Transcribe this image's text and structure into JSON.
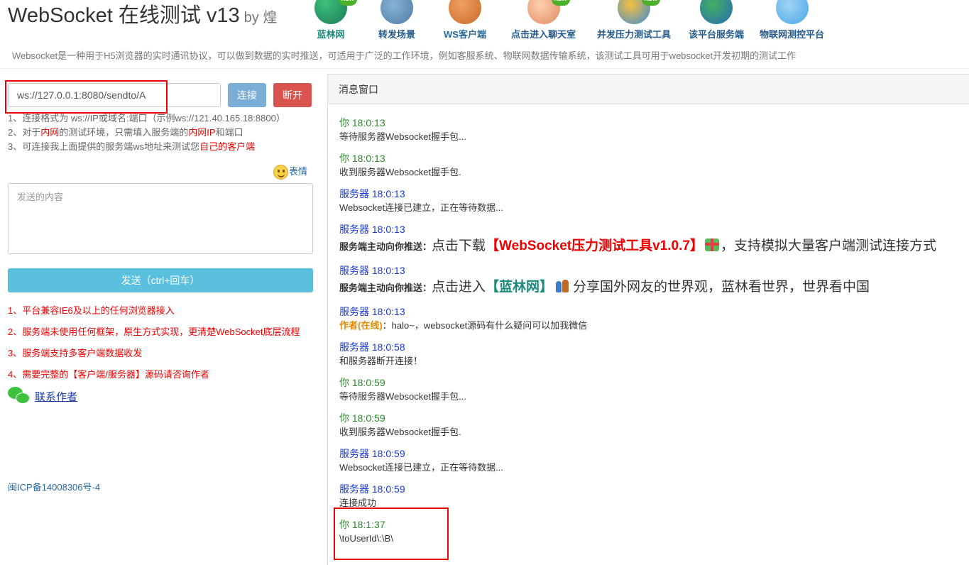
{
  "header": {
    "title": "WebSocket 在线测试 v13",
    "by": "by 煌",
    "description": "Websocket是一种用于H5浏览器的实时通讯协议，可以做到数据的实时推送，可适用于广泛的工作环境，例如客服系统、物联网数据传输系统，该测试工具可用于websocket开发初期的测试工作"
  },
  "nav": {
    "items": [
      {
        "label": "蓝林网",
        "icon": "globe-icon",
        "new": "NEW"
      },
      {
        "label": "转发场景",
        "icon": "antenna-icon"
      },
      {
        "label": "WS客户端",
        "icon": "phone-icon"
      },
      {
        "label": "点击进入聊天室",
        "icon": "chat-people-icon",
        "new": "NEW"
      },
      {
        "label": "并发压力测试工具",
        "icon": "rocket-tool-icon",
        "new": "NEW"
      },
      {
        "label": "该平台服务端",
        "icon": "server-globe-icon"
      },
      {
        "label": "物联网测控平台",
        "icon": "cloud-icon"
      }
    ]
  },
  "connect": {
    "url": "ws://127.0.0.1:8080/sendto/A",
    "connect_label": "连接",
    "disconnect_label": "断开",
    "tip1": "1、连接格式为 ws://IP或域名:端口（示例ws://121.40.165.18:8800）",
    "tip2_a": "2、对于",
    "tip2_b": "内网",
    "tip2_c": "的测试环境，只需填入服务端的",
    "tip2_d": "内网IP",
    "tip2_e": "和端口",
    "tip3_a": "3、可连接我上面提供的服务端ws地址来测试您",
    "tip3_b": "自己的客户端"
  },
  "compose": {
    "emoji_label": "表情",
    "placeholder": "发送的内容",
    "send_label": "发送（ctrl+回车）"
  },
  "features": [
    "1、平台兼容IE6及以上的任何浏览器接入",
    "2、服务端未使用任何框架，原生方式实现，更清楚WebSocket底层流程",
    "3、服务端支持多客户端数据收发",
    "4、需要完整的【客户端/服务器】源码请咨询作者"
  ],
  "contact_label": "联系作者",
  "icp": "闽ICP备14008306号-4",
  "messages_panel": {
    "title": "消息窗口",
    "messages": [
      {
        "meta": "你 18:0:13",
        "text": "等待服务器Websocket握手包..."
      },
      {
        "meta": "你 18:0:13",
        "text": "收到服务器Websocket握手包."
      },
      {
        "meta": "服务器 18:0:13",
        "text": "Websocket连接已建立，正在等待数据..."
      },
      {
        "meta": "服务器 18:0:13",
        "prefix": "服务端主动向你推送：",
        "pre": "点击下载",
        "link": "【WebSocket压力测试工具v1.0.7】",
        "post": "，支持模拟大量客户端测试连接方式"
      },
      {
        "meta": "服务器 18:0:13",
        "prefix": "服务端主动向你推送：",
        "pre": "点击进入",
        "link": "【蓝林网】",
        "post": "分享国外网友的世界观，蓝林看世界，世界看中国"
      },
      {
        "meta": "服务器 18:0:13",
        "author": "作者(在线)",
        "text": "：halo~，websocket源码有什么疑问可以加我微信"
      },
      {
        "meta": "服务器 18:0:58",
        "text": "和服务器断开连接！"
      },
      {
        "meta": "你 18:0:59",
        "text": "等待服务器Websocket握手包..."
      },
      {
        "meta": "你 18:0:59",
        "text": "收到服务器Websocket握手包."
      },
      {
        "meta": "服务器 18:0:59",
        "text": "Websocket连接已建立，正在等待数据..."
      },
      {
        "meta": "服务器 18:0:59",
        "text": "连接成功"
      },
      {
        "meta": "你 18:1:37",
        "text": "\\toUserId\\:\\B\\"
      }
    ]
  },
  "colors": {
    "you": "#2a8a2a",
    "server": "#1a3ad6",
    "highlight_box": "#ee0000",
    "connect_btn": "#7aaed6",
    "disconnect_btn": "#d9534f",
    "send_btn": "#5bc0de"
  }
}
